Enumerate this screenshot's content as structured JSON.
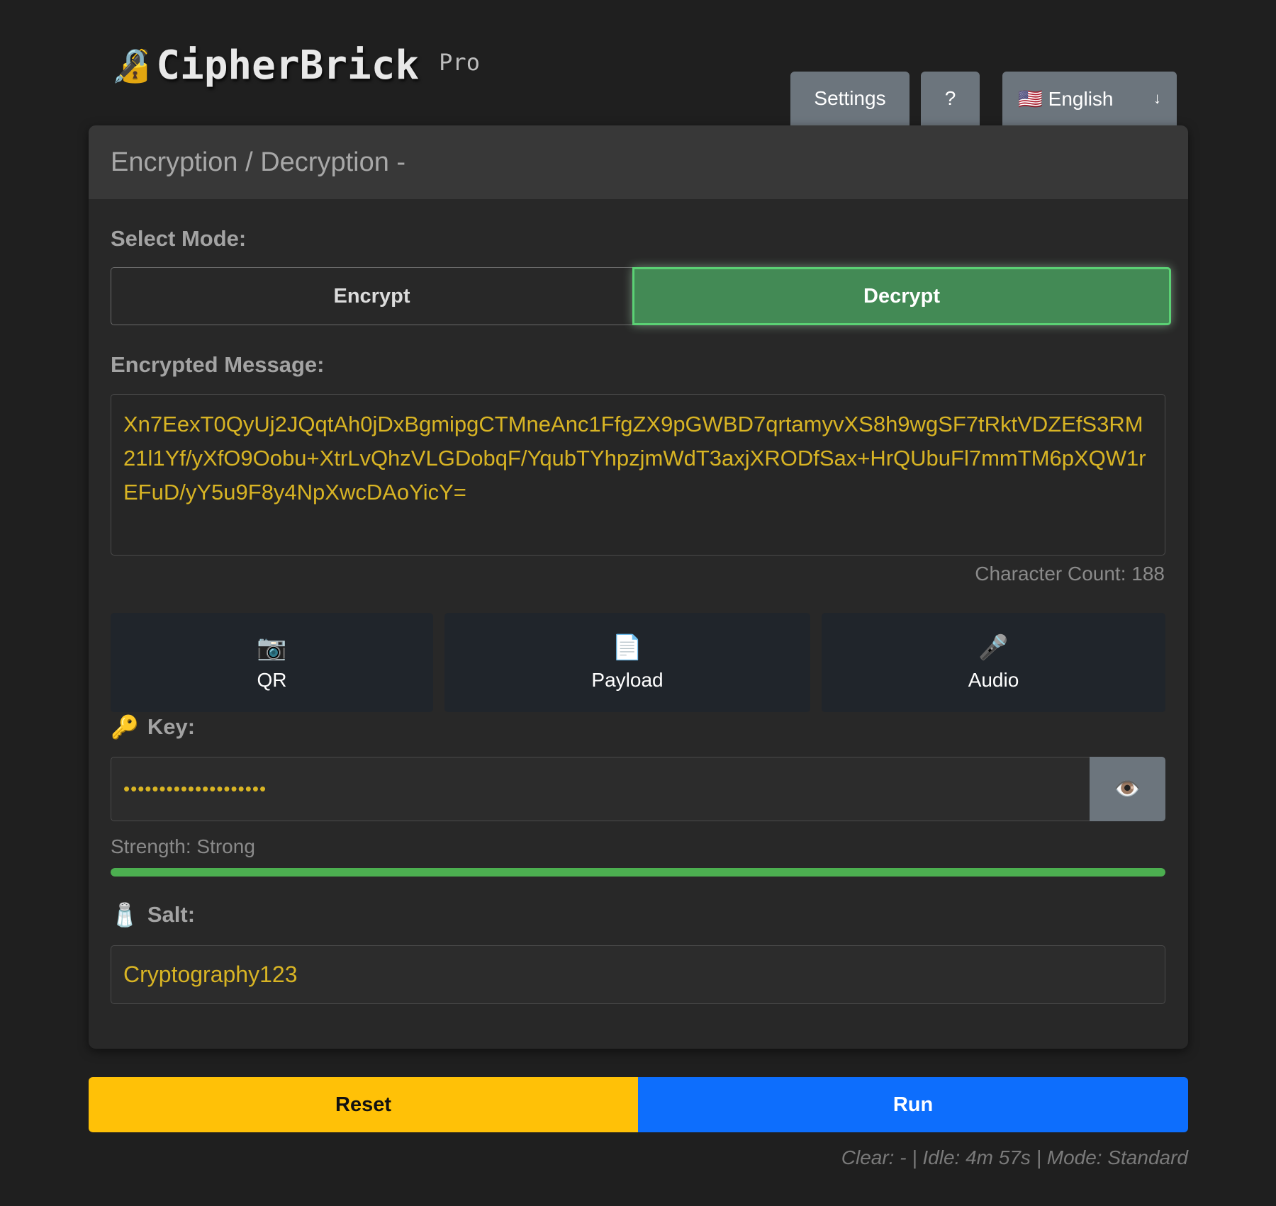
{
  "brand": {
    "lock_icon": "🔏",
    "title": "CipherBrick",
    "edition": "Pro"
  },
  "toolbar": {
    "settings_label": "Settings",
    "help_label": "?",
    "language_flag": "🇺🇸",
    "language_label": "English",
    "language_caret": "↓"
  },
  "card": {
    "header": "Encryption / Decryption -"
  },
  "mode": {
    "label": "Select Mode:",
    "encrypt_label": "Encrypt",
    "decrypt_label": "Decrypt",
    "selected": "Decrypt"
  },
  "message": {
    "label": "Encrypted Message:",
    "value": "Xn7EexT0QyUj2JQqtAh0jDxBgmipgCTMneAnc1FfgZX9pGWBD7qrtamyvXS8h9wgSF7tRktVDZEfS3RM21l1Yf/yXfO9Oobu+XtrLvQhzVLGDobqF/YqubTYhpzjmWdT3axjXRODfSax+HrQUbuFl7mmTM6pXQW1rEFuD/yY5u9F8y4NpXwcDAoYicY=",
    "char_count": "Character Count: 188"
  },
  "tools": [
    {
      "icon": "📷",
      "label": "QR"
    },
    {
      "icon": "📄",
      "label": "Payload"
    },
    {
      "icon": "🎤",
      "label": "Audio"
    }
  ],
  "key": {
    "icon": "🔑",
    "label": "Key:",
    "masked_value": "••••••••••••••••••••",
    "toggle_icon": "👁️",
    "strength_text": "Strength: Strong",
    "strength_fraction": 1.0
  },
  "salt": {
    "icon": "🧂",
    "label": "Salt:",
    "value": "Cryptography123"
  },
  "actions": {
    "reset_label": "Reset",
    "run_label": "Run"
  },
  "status": {
    "text": "Clear: - | Idle: 4m 57s | Mode: Standard"
  },
  "colors": {
    "accent_text": "#d8b424",
    "decrypt_active": "#438a55",
    "reset": "#ffc107",
    "run": "#0d6efd",
    "strength": "#4caf50"
  }
}
